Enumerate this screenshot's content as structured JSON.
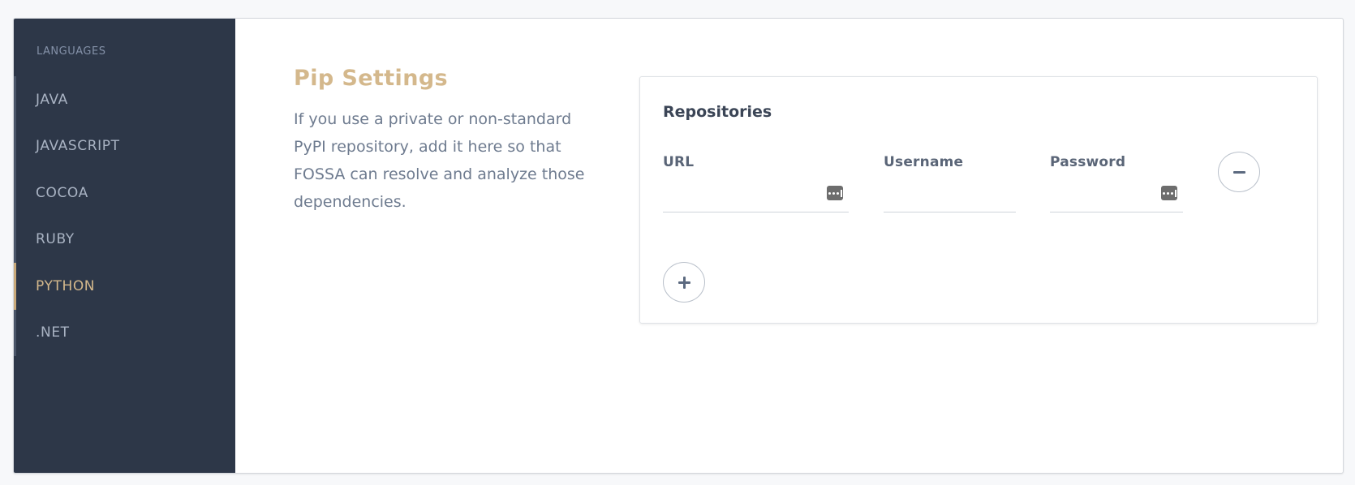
{
  "sidebar": {
    "heading": "LANGUAGES",
    "items": [
      {
        "label": "JAVA",
        "active": false
      },
      {
        "label": "JAVASCRIPT",
        "active": false
      },
      {
        "label": "COCOA",
        "active": false
      },
      {
        "label": "RUBY",
        "active": false
      },
      {
        "label": "PYTHON",
        "active": true
      },
      {
        "label": ".NET",
        "active": false
      }
    ]
  },
  "intro": {
    "title": "Pip Settings",
    "description": "If you use a private or non-standard PyPI repository, add it here so that FOSSA can resolve and analyze those dependencies."
  },
  "repositories": {
    "title": "Repositories",
    "columns": {
      "url": "URL",
      "username": "Username",
      "password": "Password"
    },
    "rows": [
      {
        "url": "",
        "username": "",
        "password": ""
      }
    ],
    "icons": {
      "password_manager": "password-manager-icon",
      "remove": "minus-icon",
      "add": "plus-icon"
    }
  },
  "colors": {
    "sidebar_bg": "#2d3748",
    "accent": "#d4b88c",
    "text_muted": "#6e7b8f"
  }
}
